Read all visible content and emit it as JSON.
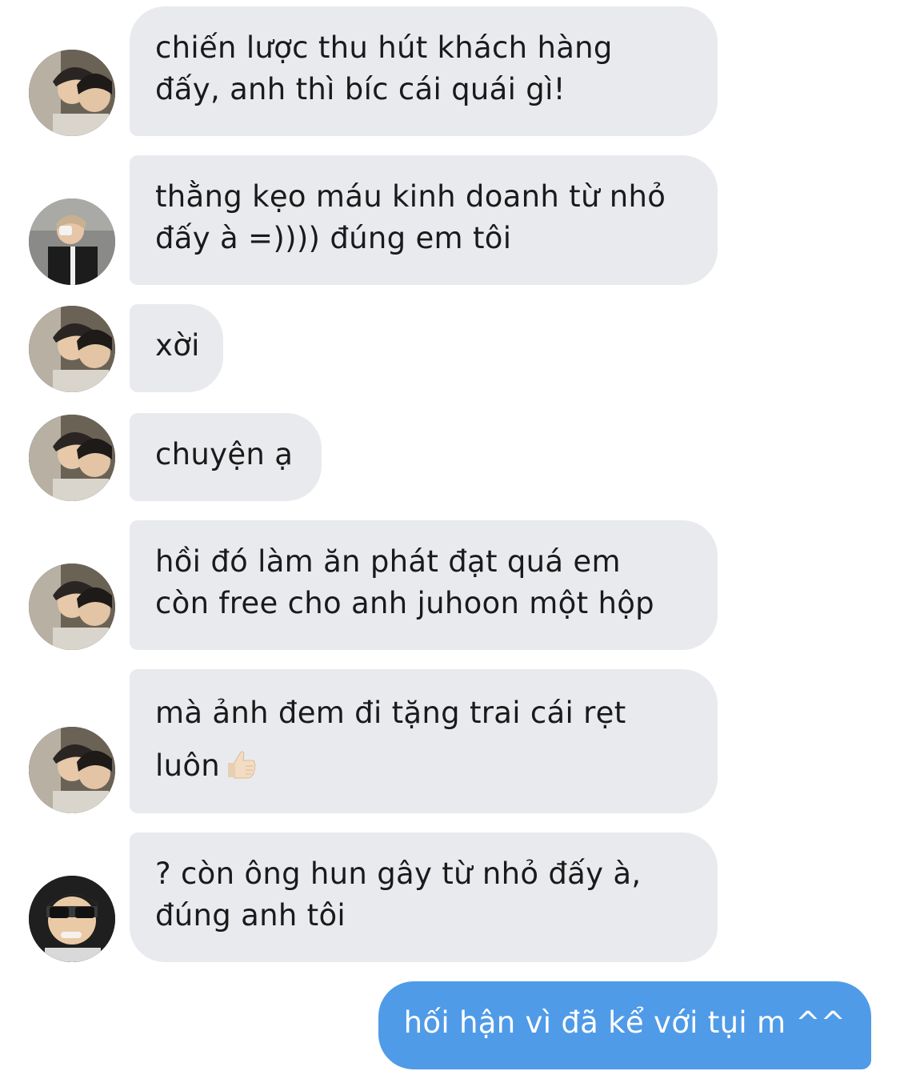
{
  "messages": [
    {
      "sender": "other",
      "avatar": "couple-avatar-icon",
      "line1": "chiến lược thu hút khách hàng",
      "line2": "đấy, anh thì bíc cái quái gì!"
    },
    {
      "sender": "other",
      "avatar": "selfie-avatar-icon",
      "line1": "thằng kẹo máu kinh doanh từ nhỏ",
      "line2": "đấy à =)))) đúng em tôi"
    },
    {
      "sender": "other",
      "avatar": "couple-avatar-icon",
      "line1": "xời"
    },
    {
      "sender": "other",
      "avatar": "couple-avatar-icon",
      "line1": "chuyện ạ"
    },
    {
      "sender": "other",
      "avatar": "couple-avatar-icon",
      "line1": "hồi đó làm ăn phát đạt quá em",
      "line2": "còn free cho anh juhoon một hộp"
    },
    {
      "sender": "other",
      "avatar": "couple-avatar-icon",
      "line1": "mà ảnh đem đi tặng trai cái rẹt",
      "line2": "luôn",
      "emoji": "thumbs-up-icon"
    },
    {
      "sender": "other",
      "avatar": "glasses-avatar-icon",
      "line1": "? còn ông hun gây từ nhỏ đấy à,",
      "line2": "đúng anh tôi"
    },
    {
      "sender": "me",
      "line1": "hối hận vì đã kể với tụi m ^^"
    }
  ],
  "colors": {
    "received_bubble": "#e9eaee",
    "sent_bubble": "#4f9be8"
  }
}
